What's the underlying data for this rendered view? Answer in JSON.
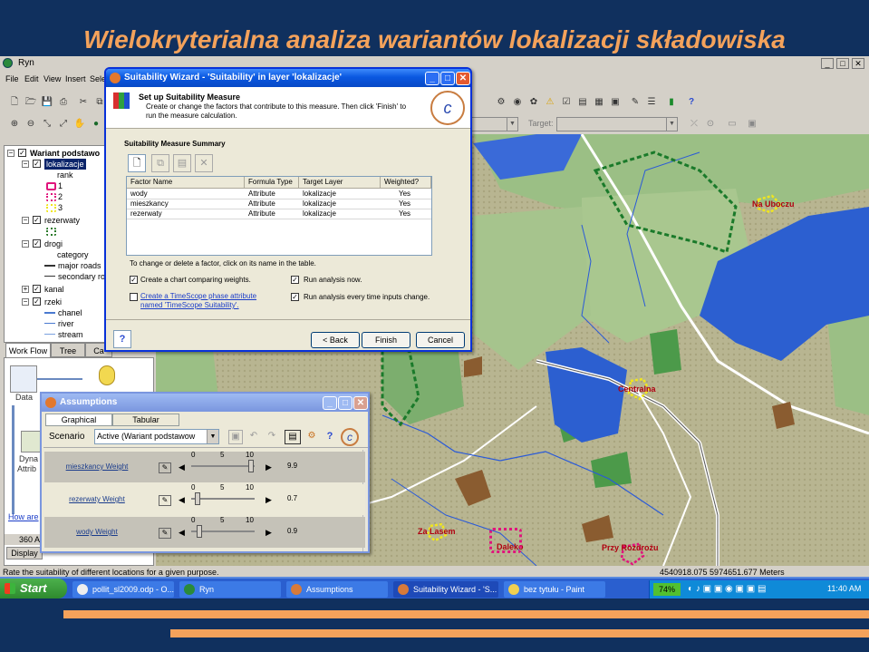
{
  "slide_title": "Wielokryterialna analiza wariantów lokalizacji składowiska",
  "app": {
    "title": "Ryn",
    "menu": [
      "File",
      "Edit",
      "View",
      "Insert",
      "Sele"
    ],
    "target_label": "Target:",
    "status_text": "Rate the suitability of different locations for a given purpose.",
    "coordinates": "4540918.075  5974651.677 Meters"
  },
  "toc": {
    "root": "Wariant podstawo",
    "layers": [
      {
        "name": "lokalizacje",
        "checked": true,
        "selected": true
      },
      {
        "name": "rank",
        "legend": true
      },
      {
        "name": "1",
        "legend": true,
        "color": "#e0147c"
      },
      {
        "name": "2",
        "legend": true,
        "color": "#e0147c"
      },
      {
        "name": "3",
        "legend": true,
        "color": "#f0e61e"
      },
      {
        "name": "rezerwaty",
        "checked": true
      },
      {
        "name": "drogi",
        "checked": true
      },
      {
        "name": "category",
        "legend": true
      },
      {
        "name": "major roads",
        "legend": true
      },
      {
        "name": "secondary road",
        "legend": true
      },
      {
        "name": "kanal",
        "checked": true
      },
      {
        "name": "rzeki",
        "checked": true
      },
      {
        "name": "chanel",
        "legend": true
      },
      {
        "name": "river",
        "legend": true
      },
      {
        "name": "stream",
        "legend": true
      }
    ],
    "tabs": [
      "Work Flow",
      "Tree",
      "Ca"
    ]
  },
  "workflow": {
    "data_label": "Data",
    "dyna_label": "Dyna",
    "attrib_label": "Attrib",
    "howare_link": "How are",
    "footer_value": "360 A",
    "display_tab": "Display"
  },
  "map": {
    "places": [
      {
        "name": "Na Uboczu"
      },
      {
        "name": "Centralna"
      },
      {
        "name": "Za Lasem"
      },
      {
        "name": "Przy Rozdrożu"
      },
      {
        "name": "Daleko"
      }
    ]
  },
  "wizard": {
    "title": "Suitability Wizard - 'Suitability' in layer 'lokalizacje'",
    "heading": "Set up Suitability Measure",
    "description": "Create or change the factors that contribute to this measure.  Then click 'Finish' to run the measure calculation.",
    "summary_label": "Suitability Measure Summary",
    "columns": [
      "Factor Name",
      "Formula Type",
      "Target Layer",
      "Weighted?"
    ],
    "rows": [
      [
        "wody",
        "Attribute",
        "lokalizacje",
        "Yes"
      ],
      [
        "mieszkancy",
        "Attribute",
        "lokalizacje",
        "Yes"
      ],
      [
        "rezerwaty",
        "Attribute",
        "lokalizacje",
        "Yes"
      ]
    ],
    "hint": "To change or delete a factor, click on its name in the table.",
    "opt_chart": "Create a chart comparing weights.",
    "opt_run_now": "Run analysis now.",
    "opt_timescope": "Create a TimeScope phase attribute named 'TimeScope Suitability'.",
    "opt_run_every": "Run analysis every time inputs change.",
    "opt_chart_checked": true,
    "opt_run_now_checked": true,
    "opt_timescope_checked": false,
    "opt_run_every_checked": true,
    "back": "< Back",
    "finish": "Finish",
    "cancel": "Cancel"
  },
  "assumptions": {
    "title": "Assumptions",
    "tabs": [
      "Graphical",
      "Tabular"
    ],
    "scenario_label": "Scenario",
    "scenario_value": "Active (Wariant podstawow",
    "scale_ticks": [
      "0",
      "5",
      "10"
    ],
    "sliders": [
      {
        "label": "mieszkancy Weight",
        "value": "9.9",
        "position": 0.99
      },
      {
        "label": "rezerwaty Weight",
        "value": "0.7",
        "position": 0.07
      },
      {
        "label": "wody Weight",
        "value": "0.9",
        "position": 0.09
      }
    ]
  },
  "taskbar": {
    "start": "Start",
    "items": [
      "pollit_sl2009.odp - O...",
      "Ryn",
      "Assumptions",
      "Suitability Wizard - 'S...",
      "bez tytułu - Paint"
    ],
    "battery": "74%",
    "clock": "11:40 AM"
  }
}
